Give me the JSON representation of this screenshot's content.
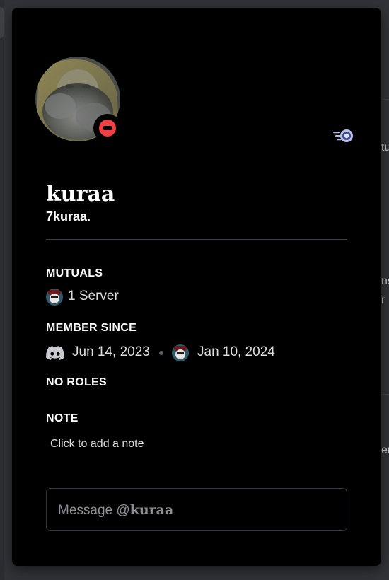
{
  "profile": {
    "display_name": "kuraa",
    "username": "7kuraa.",
    "status": "do-not-disturb",
    "status_color": "#f23f43",
    "badge_icon": "nitro-badge-icon"
  },
  "mutuals": {
    "title": "MUTUALS",
    "servers_label": "1 Server"
  },
  "member_since": {
    "title": "MEMBER SINCE",
    "discord_date": "Jun 14, 2023",
    "server_date": "Jan 10, 2024"
  },
  "roles": {
    "title": "NO ROLES"
  },
  "note": {
    "title": "NOTE",
    "placeholder": "Click to add a note"
  },
  "message": {
    "prefix": "Message @",
    "name": "kuraa"
  },
  "background": {
    "fragments": [
      "tu",
      "ns",
      "r",
      "er"
    ]
  },
  "colors": {
    "card_bg": "#000000",
    "page_bg": "#313338",
    "text_primary": "#ffffff",
    "text_secondary": "#dbdee1",
    "muted": "#8e9097"
  }
}
